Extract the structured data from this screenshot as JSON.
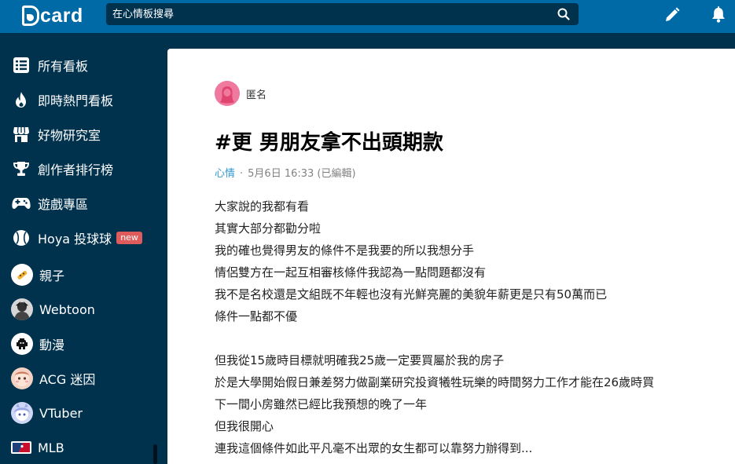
{
  "header": {
    "logo_text": "card",
    "search_placeholder": "在心情板搜尋"
  },
  "sidebar": {
    "items": [
      {
        "label": "所有看板",
        "icon": "list-icon"
      },
      {
        "label": "即時熱門看板",
        "icon": "fire-icon"
      },
      {
        "label": "好物研究室",
        "icon": "shop-icon"
      },
      {
        "label": "創作者排行榜",
        "icon": "trophy-icon"
      },
      {
        "label": "遊戲專區",
        "icon": "gamepad-icon"
      },
      {
        "label": "Hoya 投球球",
        "icon": "baseball-icon",
        "badge": "new"
      },
      {
        "label": "親子",
        "icon": "parenting-board-icon"
      },
      {
        "label": "Webtoon",
        "icon": "webtoon-board-icon"
      },
      {
        "label": "動漫",
        "icon": "anime-board-icon"
      },
      {
        "label": "ACG 迷因",
        "icon": "acg-meme-board-icon"
      },
      {
        "label": "VTuber",
        "icon": "vtuber-board-icon"
      },
      {
        "label": "MLB",
        "icon": "mlb-board-icon"
      }
    ]
  },
  "post": {
    "author": "匿名",
    "title_hash": "#",
    "title_text": "更 男朋友拿不出頭期款",
    "board": "心情",
    "separator": "·",
    "timestamp": "5月6日 16:33 (已編輯)",
    "lines": [
      "大家說的我都有看",
      "其實大部分都勸分啦",
      "我的確也覺得男友的條件不是我要的所以我想分手",
      "情侶雙方在一起互相審核條件我認為一點問題都沒有",
      "我不是名校還是文組既不年輕也沒有光鮮亮麗的美貌年薪更是只有50萬而已",
      "條件一點都不優",
      "",
      "但我從15歲時目標就明確我25歲一定要買屬於我的房子",
      "於是大學開始假日兼差努力做副業研究投資犧牲玩樂的時間努力工作才能在26歲時買",
      "下一間小房雖然已經比我預想的晚了一年",
      "但我很開心",
      "連我這個條件如此平凡毫不出眾的女生都可以靠努力辦得到..."
    ]
  },
  "colors": {
    "header_bg": "#006aa6",
    "sidebar_bg": "#00324e",
    "board_link": "#3397cf",
    "badge_bg": "#e05c5c"
  }
}
